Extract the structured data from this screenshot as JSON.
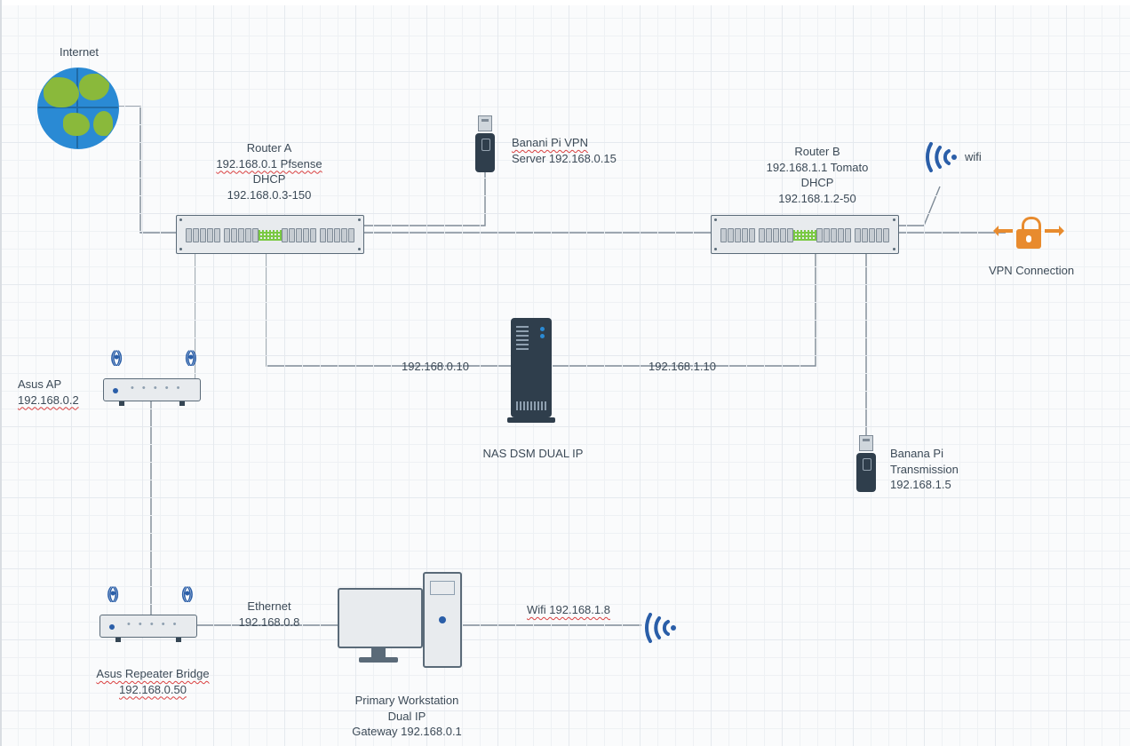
{
  "internet": {
    "label": "Internet"
  },
  "routerA": {
    "title": "Router A",
    "ip_line": "192.168.0.1 Pfsense",
    "dhcp_label": "DHCP",
    "dhcp_range": "192.168.0.3-150"
  },
  "routerB": {
    "title": "Router B",
    "ip_line": "192.168.1.1 Tomato",
    "dhcp_label": "DHCP",
    "dhcp_range": "192.168.1.2-50"
  },
  "wifi_b": {
    "label": "wifi"
  },
  "vpn_conn": {
    "label": "VPN Connection"
  },
  "banani_vpn": {
    "line1": "Banani Pi VPN",
    "line2": "Server 192.168.0.15"
  },
  "asus_ap": {
    "line1": "Asus AP",
    "line2": "192.168.0.2"
  },
  "nas": {
    "ip_left": "192.168.0.10",
    "ip_right": "192.168.1.10",
    "label": "NAS DSM DUAL IP"
  },
  "banana_tx": {
    "line1": "Banana Pi",
    "line2": "Transmission",
    "line3": "192.168.1.5"
  },
  "asus_rep": {
    "line1": "Asus Repeater Bridge",
    "line2": "192.168.0.50"
  },
  "eth_link": {
    "line1": "Ethernet",
    "line2": "192.168.0.8"
  },
  "wifi_link": {
    "label": "Wifi 192.168.1.8"
  },
  "workstation": {
    "line1": "Primary Workstation",
    "line2": "Dual IP",
    "line3": "Gateway 192.168.0.1"
  },
  "colors": {
    "wire": "#7e8a96",
    "accent": "#2a5ea8",
    "device": "#2f3e4c",
    "green": "#8ab93b",
    "orange": "#e88b2e"
  }
}
